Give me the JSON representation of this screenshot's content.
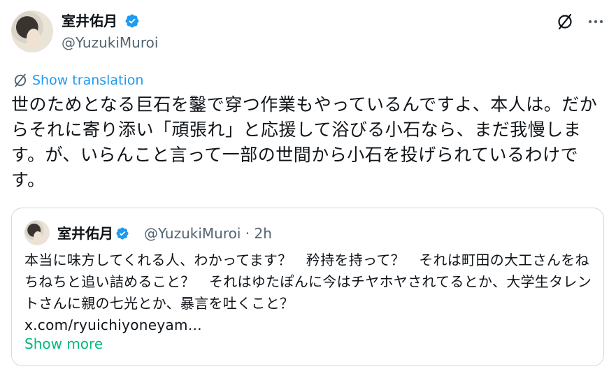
{
  "author": {
    "display_name": "室井佑月",
    "handle": "@YuzukiMuroi",
    "verified": true
  },
  "icons": {
    "verified": "verified-badge-icon",
    "no_translate": "translate-icon",
    "more": "more-options-icon"
  },
  "translate": {
    "label": "Show translation"
  },
  "tweet": {
    "text": "世のためとなる巨石を鑿で穿つ作業もやっているんですよ、本人は。だからそれに寄り添い「頑張れ」と応援して浴びる小石なら、まだ我慢します。が、いらんこと言って一部の世間から小石を投げられているわけです。"
  },
  "quote": {
    "display_name": "室井佑月",
    "handle": "@YuzukiMuroi",
    "separator": "·",
    "time": "2h",
    "text": "本当に味方してくれる人、わかってます？　矜持を持って？　それは町田の大工さんをねちねちと追い詰めること？　それはゆたぽんに今はチヤホヤされてるとか、大学生タレントさんに親の七光とか、暴言を吐くこと？",
    "link": "x.com/ryuichiyoneyam…",
    "show_more": "Show more"
  },
  "colors": {
    "accent": "#1d9bf0",
    "show_more": "#00ba7c",
    "secondary_text": "#536471",
    "border": "#cfd9de"
  }
}
